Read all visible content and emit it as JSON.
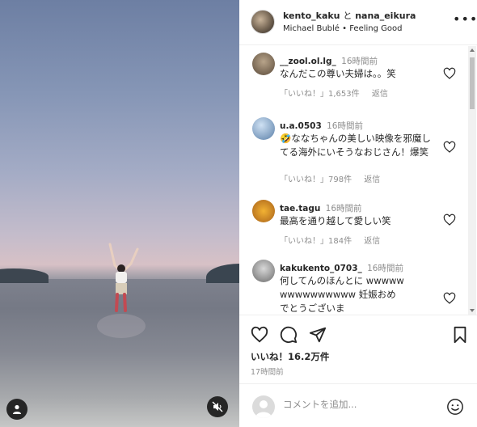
{
  "post": {
    "author1": "kento_kaku",
    "and_word": "と",
    "author2": "nana_eikura",
    "song": "Michael Bublé • Feeling Good",
    "more_label": "•••"
  },
  "comments": [
    {
      "user": "__zool.ol.lg_",
      "time": "16時間前",
      "text": "なんだこの尊い夫婦は。。笑",
      "likes": "「いいね！」1,653件",
      "reply": "返信"
    },
    {
      "user": "u.a.0503",
      "time": "16時間前",
      "text": "🤣ななちゃんの美しい映像を邪魔してる海外にいそうなおじさん！爆笑",
      "likes": "「いいね！」798件",
      "reply": "返信"
    },
    {
      "user": "tae.tagu",
      "time": "16時間前",
      "text": "最高を通り越して愛しい笑",
      "likes": "「いいね！」184件",
      "reply": "返信"
    },
    {
      "user": "kakukento_0703_",
      "time": "16時間前",
      "text": "何してんのほんとに wwwwwwwwwwwwwww 妊娠おめでとうございま",
      "likes": "",
      "reply": ""
    }
  ],
  "actions": {
    "likes": "いいね！16.2万件",
    "time_ago": "17時間前"
  },
  "add_comment": {
    "placeholder": "コメントを追加..."
  },
  "icons": {
    "heart": "heart-icon",
    "comment": "comment-icon",
    "share": "share-icon",
    "save": "bookmark-icon",
    "emoji": "emoji-icon",
    "mute": "muted-speaker-icon",
    "user_tag": "user-tag-icon"
  }
}
